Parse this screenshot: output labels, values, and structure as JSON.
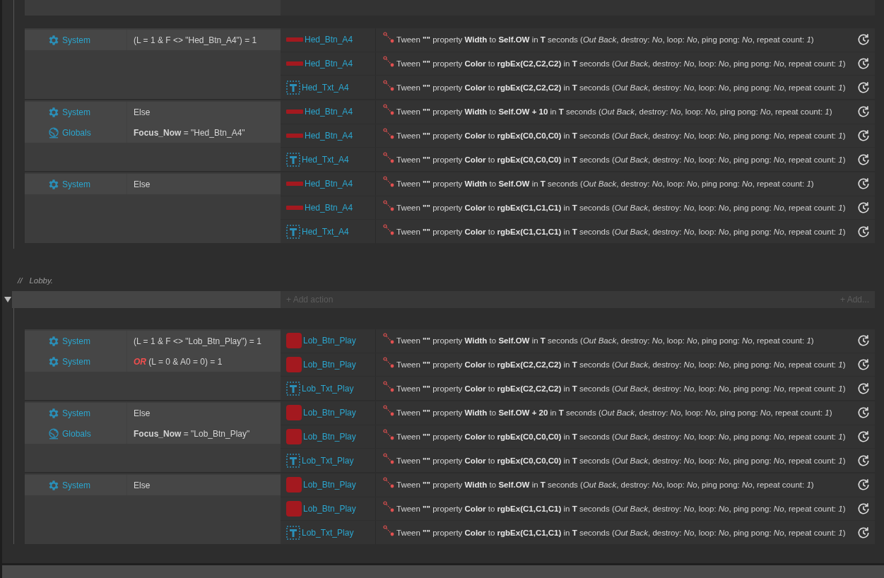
{
  "sections": [
    {
      "events": [
        {
          "conditions": [
            {
              "kind": "system",
              "label": "System",
              "text": "(L = 1 & F <> \"Hed_Btn_A4\") = 1"
            }
          ],
          "actions": [
            {
              "kind": "sprite-bar",
              "name": "Hed_Btn_A4",
              "text": "Tween **\"\"** property **Width** to **Self.OW** in **T** seconds (*Out Back*, destroy: *No*, loop: *No*, ping pong: *No*, repeat count: *1*)"
            },
            {
              "kind": "sprite-bar",
              "name": "Hed_Btn_A4",
              "text": "Tween **\"\"** property **Color** to **rgbEx(C2,C2,C2)** in **T** seconds (*Out Back*, destroy: *No*, loop: *No*, ping pong: *No*, repeat count: *1*)"
            },
            {
              "kind": "text",
              "name": "Hed_Txt_A4",
              "text": "Tween **\"\"** property **Color** to **rgbEx(C2,C2,C2)** in **T** seconds (*Out Back*, destroy: *No*, loop: *No*, ping pong: *No*, repeat count: *1*)"
            }
          ]
        },
        {
          "conditions": [
            {
              "kind": "system",
              "label": "System",
              "text": "Else"
            },
            {
              "kind": "globals",
              "label": "Globals",
              "text": "**Focus_Now** = \"Hed_Btn_A4\""
            }
          ],
          "actions": [
            {
              "kind": "sprite-bar",
              "name": "Hed_Btn_A4",
              "text": "Tween **\"\"** property **Width** to **Self.OW + 10** in **T** seconds (*Out Back*, destroy: *No*, loop: *No*, ping pong: *No*, repeat count: *1*)"
            },
            {
              "kind": "sprite-bar",
              "name": "Hed_Btn_A4",
              "text": "Tween **\"\"** property **Color** to **rgbEx(C0,C0,C0)** in **T** seconds (*Out Back*, destroy: *No*, loop: *No*, ping pong: *No*, repeat count: *1*)"
            },
            {
              "kind": "text",
              "name": "Hed_Txt_A4",
              "text": "Tween **\"\"** property **Color** to **rgbEx(C0,C0,C0)** in **T** seconds (*Out Back*, destroy: *No*, loop: *No*, ping pong: *No*, repeat count: *1*)"
            }
          ]
        },
        {
          "conditions": [
            {
              "kind": "system",
              "label": "System",
              "text": "Else"
            }
          ],
          "actions": [
            {
              "kind": "sprite-bar",
              "name": "Hed_Btn_A4",
              "text": "Tween **\"\"** property **Width** to **Self.OW** in **T** seconds (*Out Back*, destroy: *No*, loop: *No*, ping pong: *No*, repeat count: *1*)"
            },
            {
              "kind": "sprite-bar",
              "name": "Hed_Btn_A4",
              "text": "Tween **\"\"** property **Color** to **rgbEx(C1,C1,C1)** in **T** seconds (*Out Back*, destroy: *No*, loop: *No*, ping pong: *No*, repeat count: *1*)"
            },
            {
              "kind": "text",
              "name": "Hed_Txt_A4",
              "text": "Tween **\"\"** property **Color** to **rgbEx(C1,C1,C1)** in **T** seconds (*Out Back*, destroy: *No*, loop: *No*, ping pong: *No*, repeat count: *1*)"
            }
          ]
        }
      ]
    },
    {
      "comment_mark": "//",
      "comment": "Lobby.",
      "group": {
        "expanded": true,
        "add_action": "+ Add action",
        "add": "+ Add..."
      },
      "events": [
        {
          "conditions": [
            {
              "kind": "system",
              "label": "System",
              "text": "(L = 1 & F <> \"Lob_Btn_Play\") = 1"
            },
            {
              "kind": "system",
              "label": "System",
              "or": "OR",
              "text": "(L = 0 & A0 = 0) = 1"
            }
          ],
          "actions": [
            {
              "kind": "sprite-square",
              "name": "Lob_Btn_Play",
              "text": "Tween **\"\"** property **Width** to **Self.OW** in **T** seconds (*Out Back*, destroy: *No*, loop: *No*, ping pong: *No*, repeat count: *1*)"
            },
            {
              "kind": "sprite-square",
              "name": "Lob_Btn_Play",
              "text": "Tween **\"\"** property **Color** to **rgbEx(C2,C2,C2)** in **T** seconds (*Out Back*, destroy: *No*, loop: *No*, ping pong: *No*, repeat count: *1*)"
            },
            {
              "kind": "text",
              "name": "Lob_Txt_Play",
              "text": "Tween **\"\"** property **Color** to **rgbEx(C2,C2,C2)** in **T** seconds (*Out Back*, destroy: *No*, loop: *No*, ping pong: *No*, repeat count: *1*)"
            }
          ]
        },
        {
          "conditions": [
            {
              "kind": "system",
              "label": "System",
              "text": "Else"
            },
            {
              "kind": "globals",
              "label": "Globals",
              "text": "**Focus_Now** = \"Lob_Btn_Play\""
            }
          ],
          "actions": [
            {
              "kind": "sprite-square",
              "name": "Lob_Btn_Play",
              "text": "Tween **\"\"** property **Width** to **Self.OW + 20** in **T** seconds (*Out Back*, destroy: *No*, loop: *No*, ping pong: *No*, repeat count: *1*)"
            },
            {
              "kind": "sprite-square",
              "name": "Lob_Btn_Play",
              "text": "Tween **\"\"** property **Color** to **rgbEx(C0,C0,C0)** in **T** seconds (*Out Back*, destroy: *No*, loop: *No*, ping pong: *No*, repeat count: *1*)"
            },
            {
              "kind": "text",
              "name": "Lob_Txt_Play",
              "text": "Tween **\"\"** property **Color** to **rgbEx(C0,C0,C0)** in **T** seconds (*Out Back*, destroy: *No*, loop: *No*, ping pong: *No*, repeat count: *1*)"
            }
          ]
        },
        {
          "conditions": [
            {
              "kind": "system",
              "label": "System",
              "text": "Else"
            }
          ],
          "actions": [
            {
              "kind": "sprite-square",
              "name": "Lob_Btn_Play",
              "text": "Tween **\"\"** property **Width** to **Self.OW** in **T** seconds (*Out Back*, destroy: *No*, loop: *No*, ping pong: *No*, repeat count: *1*)"
            },
            {
              "kind": "sprite-square",
              "name": "Lob_Btn_Play",
              "text": "Tween **\"\"** property **Color** to **rgbEx(C1,C1,C1)** in **T** seconds (*Out Back*, destroy: *No*, loop: *No*, ping pong: *No*, repeat count: *1*)"
            },
            {
              "kind": "text",
              "name": "Lob_Txt_Play",
              "text": "Tween **\"\"** property **Color** to **rgbEx(C1,C1,C1)** in **T** seconds (*Out Back*, destroy: *No*, loop: *No*, ping pong: *No*, repeat count: *1*)"
            }
          ]
        }
      ]
    }
  ]
}
